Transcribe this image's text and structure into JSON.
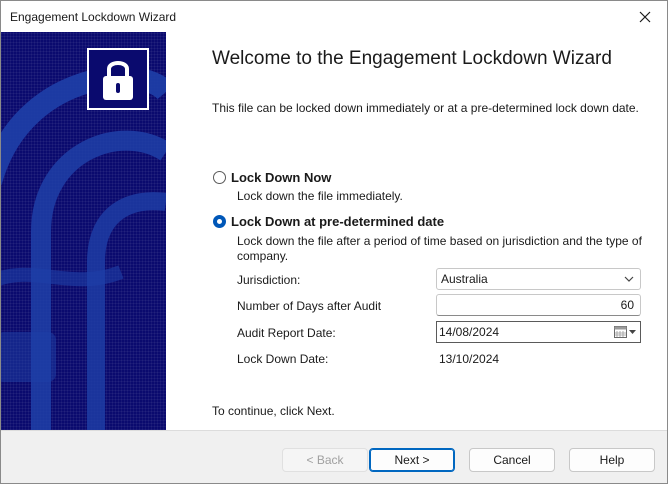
{
  "window": {
    "title": "Engagement Lockdown Wizard"
  },
  "icons": {
    "close": "close-icon",
    "lock": "lock-icon",
    "dropdown": "chevron-down-icon",
    "calendar": "calendar-icon"
  },
  "colors": {
    "side_panel": "#0a0a6e",
    "accent": "#0067c0"
  },
  "content": {
    "heading": "Welcome to the Engagement Lockdown Wizard",
    "intro": "This file can be locked down immediately or at a pre-determined lock down date.",
    "options": [
      {
        "label": "Lock Down Now",
        "description": "Lock down the file immediately.",
        "selected": false
      },
      {
        "label": "Lock Down at pre-determined date",
        "description": "Lock down the file after a period of time based on jurisdiction and the type of company.",
        "selected": true
      }
    ],
    "fields": {
      "jurisdiction_label": "Jurisdiction:",
      "jurisdiction_value": "Australia",
      "days_label": "Number of Days after Audit",
      "days_value": "60",
      "audit_date_label": "Audit Report Date:",
      "audit_date_value": "14/08/2024",
      "lockdown_date_label": "Lock Down Date:",
      "lockdown_date_value": "13/10/2024"
    },
    "footer": "To continue, click Next."
  },
  "buttons": {
    "back": "< Back",
    "next": "Next >",
    "cancel": "Cancel",
    "help": "Help"
  }
}
